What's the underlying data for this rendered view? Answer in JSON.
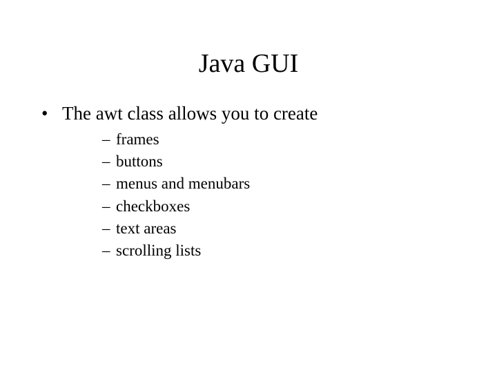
{
  "title": "Java GUI",
  "bullet": "The awt class allows you to create",
  "subitems": [
    "frames",
    "buttons",
    "menus and menubars",
    "checkboxes",
    "text areas",
    "scrolling lists"
  ]
}
